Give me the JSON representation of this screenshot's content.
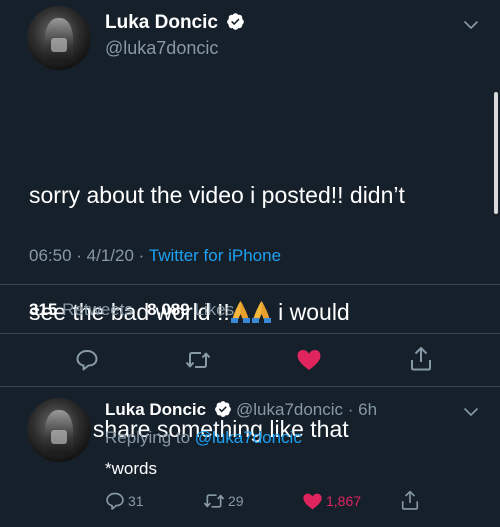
{
  "main_tweet": {
    "author_name": "Luka Doncic",
    "handle": "@luka7doncic",
    "text_line1": "sorry about the video i posted!! didn’t",
    "text_line2_start": "see the bad world !!",
    "text_line2_end": " i would",
    "text_line3": "never share something like that",
    "emoji": "folded-hands",
    "time": "06:50",
    "date": "4/1/20",
    "source": "Twitter for iPhone",
    "retweet_count": "315",
    "retweets_label": "Retweets",
    "like_count": "8,089",
    "likes_label": "Likes",
    "liked": true
  },
  "reply_tweet": {
    "author_name": "Luka Doncic",
    "handle": "@luka7doncic",
    "age": "6h",
    "replying_to_label": "Replying to",
    "replying_to_handle": "@luka7doncic",
    "text": "*words",
    "reply_count": "31",
    "retweet_count": "29",
    "like_count": "1,867",
    "liked": true
  },
  "colors": {
    "background": "#15202b",
    "secondary_text": "#8899a6",
    "accent": "#1da1f2",
    "like": "#e0245e",
    "verified": "#ffffff"
  }
}
